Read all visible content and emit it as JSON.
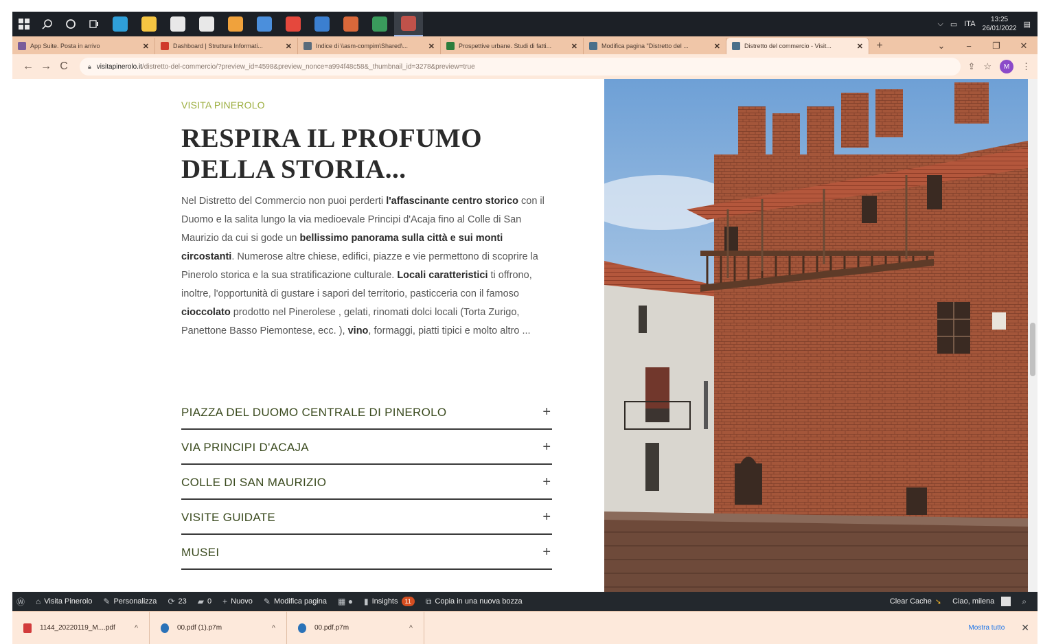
{
  "taskbar": {
    "icons": [
      "windows-icon",
      "search-icon",
      "cortana-icon",
      "task-view-icon"
    ],
    "apps": [
      {
        "name": "edge-app-icon",
        "color": "#2f9fd8"
      },
      {
        "name": "file-explorer-app-icon",
        "color": "#f5c542"
      },
      {
        "name": "store-app-icon",
        "color": "#e8e8e8"
      },
      {
        "name": "mail-app-icon",
        "color": "#e8e8e8"
      },
      {
        "name": "media-app-icon",
        "color": "#f0a23c"
      },
      {
        "name": "calculator-app-icon",
        "color": "#4b8fdc"
      },
      {
        "name": "chrome-app-icon",
        "color": "#e5483d"
      },
      {
        "name": "publisher-app-icon",
        "color": "#3b7fd0"
      },
      {
        "name": "powerpoint-app-icon",
        "color": "#d9683a"
      },
      {
        "name": "excel-app-icon",
        "color": "#3a9b5c"
      },
      {
        "name": "chrome-profile-app-icon",
        "color": "#c0524a"
      }
    ],
    "lang": "ITA",
    "time": "13:25",
    "date": "26/01/2022"
  },
  "tabs": [
    {
      "label": "App Suite. Posta in arrivo",
      "fav_color": "#7a5c9a"
    },
    {
      "label": "Dashboard | Struttura Informati...",
      "fav_color": "#d0392b"
    },
    {
      "label": "Indice di \\\\asm-compim\\Shared\\...",
      "fav_color": "#5a6b7b"
    },
    {
      "label": "Prospettive urbane. Studi di fatti...",
      "fav_color": "#2b7d3c"
    },
    {
      "label": "Modifica pagina \"Distretto del ...",
      "fav_color": "#4a6f8a"
    },
    {
      "label": "Distretto del commercio - Visit...",
      "fav_color": "#4a6f8a"
    }
  ],
  "address": {
    "host": "visitapinerolo.it",
    "path": "/distretto-del-commercio/?preview_id=4598&preview_nonce=a994f48c58&_thumbnail_id=3278&preview=true",
    "profile_initial": "M"
  },
  "page": {
    "eyebrow": "VISITA PINEROLO",
    "headline": "RESPIRA IL PROFUMO DELLA STORIA...",
    "body": [
      {
        "t": "Nel Distretto del Commercio non puoi perderti ",
        "b": false
      },
      {
        "t": "l'affascinante  centro storico",
        "b": true
      },
      {
        "t": " con il Duomo e la salita lungo la via medioevale Principi d'Acaja fino al Colle di San Maurizio da cui si gode un ",
        "b": false
      },
      {
        "t": "bellissimo panorama sulla città e sui monti circostanti",
        "b": true
      },
      {
        "t": ". Numerose altre chiese, edifici, piazze e vie permettono di scoprire la Pinerolo storica e la sua stratificazione culturale. ",
        "b": false
      },
      {
        "t": "Locali caratteristici",
        "b": true
      },
      {
        "t": " ti offrono, inoltre, l'opportunità di gustare i sapori del territorio,  pasticceria con il famoso ",
        "b": false
      },
      {
        "t": "cioccolato",
        "b": true
      },
      {
        "t": " prodotto nel Pinerolese , gelati, rinomati dolci locali (Torta Zurigo, Panettone Basso Piemontese, ecc. ), ",
        "b": false
      },
      {
        "t": "vino",
        "b": true
      },
      {
        "t": ", formaggi, piatti tipici e molto altro ...",
        "b": false
      }
    ],
    "accordion": [
      "PIAZZA DEL DUOMO CENTRALE DI PINEROLO",
      "VIA PRINCIPI D'ACAJA",
      "COLLE DI SAN MAURIZIO",
      "VISITE GUIDATE",
      "MUSEI"
    ],
    "accordion_toggle": "+",
    "accent_color": "#9cae3f"
  },
  "wpbar": {
    "site": "Visita Pinerolo",
    "customize": "Personalizza",
    "updates": "23",
    "comments": "0",
    "new": "Nuovo",
    "edit": "Modifica pagina",
    "insights": "Insights",
    "insights_badge": "11",
    "copy_draft": "Copia in una nuova bozza",
    "clear_cache": "Clear Cache",
    "greeting": "Ciao, milena"
  },
  "downloads": {
    "items": [
      {
        "name": "1144_20220119_M....pdf",
        "color": "#d23b3b"
      },
      {
        "name": "00.pdf (1).p7m",
        "color": "#2a72b8"
      },
      {
        "name": "00.pdf.p7m",
        "color": "#2a72b8"
      }
    ],
    "show_all": "Mostra tutto"
  }
}
